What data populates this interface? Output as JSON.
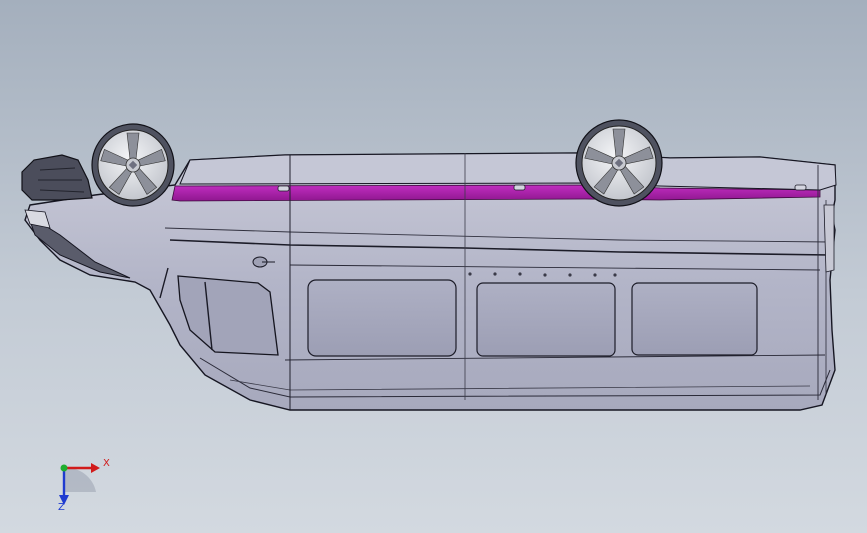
{
  "viewport": {
    "colors": {
      "background_top": "#a4afbd",
      "background_bottom": "#d3d9e0",
      "body": "#b7b9cb",
      "stripe": "#b21fb2",
      "wheel": "#e4e6ea"
    }
  },
  "model": {
    "parts": [
      "van-body",
      "roof-stripe",
      "front-wheel",
      "rear-wheel",
      "side-windows",
      "door-handle",
      "front-bumper"
    ]
  },
  "triad": {
    "x_label": "X",
    "z_label": "Z",
    "x_color": "#d11b1b",
    "y_color": "#1fae2f",
    "z_color": "#1f3bd0"
  }
}
